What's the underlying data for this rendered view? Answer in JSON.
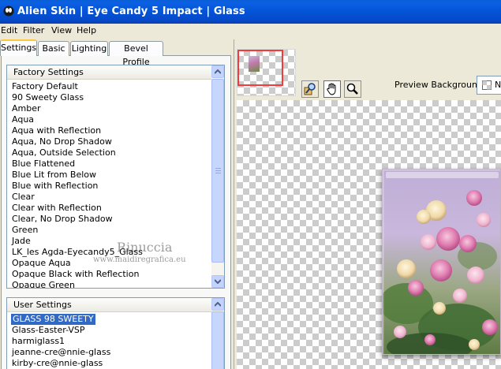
{
  "window": {
    "title": "Alien Skin | Eye Candy 5 Impact | Glass",
    "title_color": "#0453d6"
  },
  "menu": [
    "Edit",
    "Filter",
    "View",
    "Help"
  ],
  "tabs": [
    "Settings",
    "Basic",
    "Lighting",
    "Bevel Profile"
  ],
  "factory_settings": {
    "header": "Factory Settings",
    "items": [
      "Factory Default",
      "90 Sweety Glass",
      "Amber",
      "Aqua",
      "Aqua with Reflection",
      "Aqua, No Drop Shadow",
      "Aqua, Outside Selection",
      "Blue Flattened",
      "Blue Lit from Below",
      "Blue with Reflection",
      "Clear",
      "Clear with Reflection",
      "Clear, No Drop Shadow",
      "Green",
      "Jade",
      "LK_les Agda-Eyecandy5_Glass",
      "Opaque Aqua",
      "Opaque Black with Reflection",
      "Opaque Green"
    ]
  },
  "user_settings": {
    "header": "User Settings",
    "items": [
      "GLASS 98 SWEETY",
      "Glass-Easter-VSP",
      "harmiglass1",
      "jeanne-cre@nnie-glass",
      "kirby-cre@nnie-glass"
    ],
    "selected_index": 0,
    "selection_color": "#316ac5"
  },
  "toolbar": {
    "icons": [
      "navigator-icon",
      "hand-tool-icon",
      "zoom-tool-icon"
    ]
  },
  "preview": {
    "background_label": "Preview Background:"
  },
  "watermark": {
    "name": "Rinuccia",
    "site": "www.maidiregrafica.eu"
  }
}
